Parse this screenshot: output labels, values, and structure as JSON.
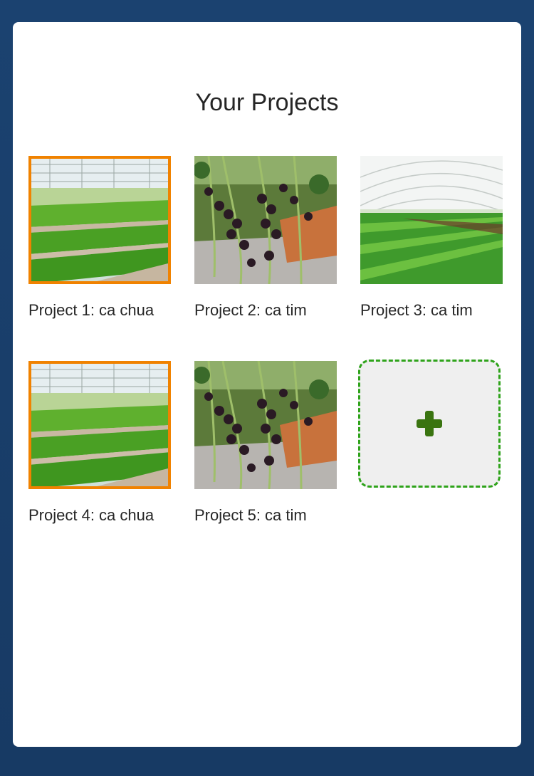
{
  "page": {
    "title": "Your Projects"
  },
  "projects": [
    {
      "label": "Project 1: ca chua",
      "image": "greenhouse-lettuce-rows",
      "selected": true
    },
    {
      "label": "Project 2: ca tim",
      "image": "eggplant-vines",
      "selected": false
    },
    {
      "label": "Project 3: ca tim",
      "image": "greenhouse-tunnel-greens",
      "selected": false
    },
    {
      "label": "Project 4: ca chua",
      "image": "greenhouse-lettuce-rows",
      "selected": true
    },
    {
      "label": "Project 5: ca tim",
      "image": "eggplant-vines",
      "selected": false
    }
  ],
  "add_tile": {
    "icon": "plus-icon"
  },
  "colors": {
    "background": "#1b4270",
    "selected_border": "#f08200",
    "add_border": "#2ea31a",
    "plus": "#3a7410"
  }
}
